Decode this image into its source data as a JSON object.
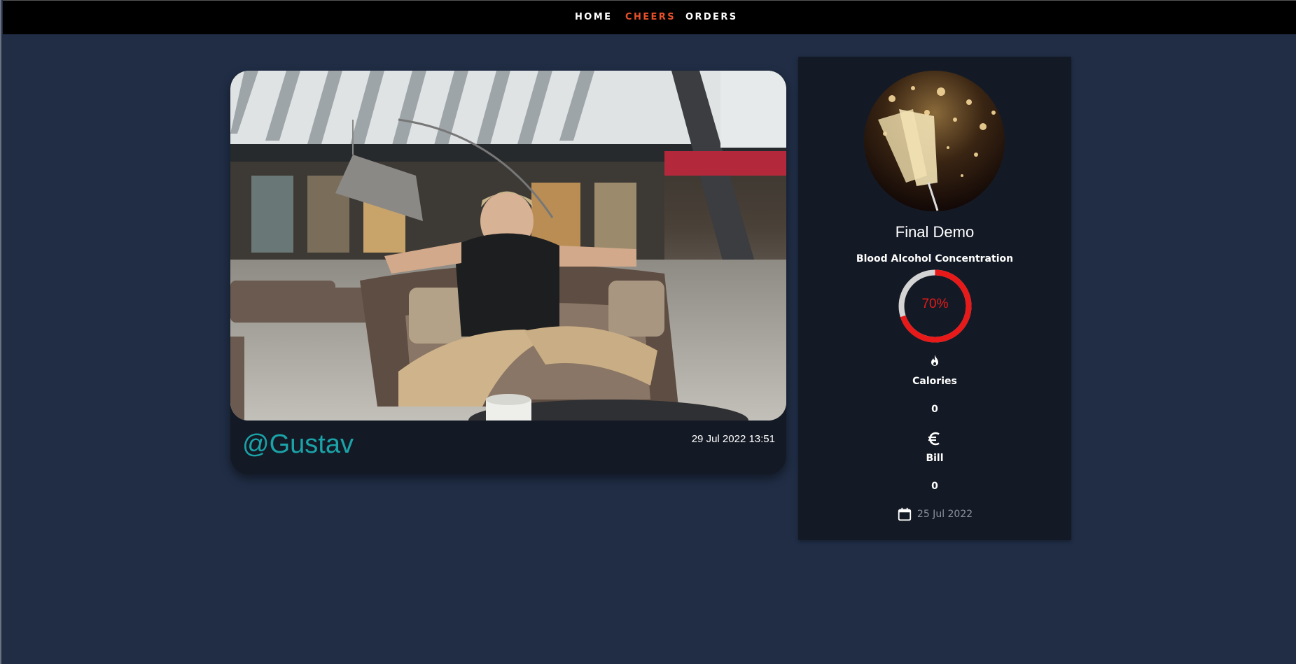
{
  "nav": {
    "items": [
      {
        "label": "HOME",
        "active": false
      },
      {
        "label": "CHEERS",
        "active": true
      },
      {
        "label": "ORDERS",
        "active": false
      }
    ],
    "active_color": "#e8502b"
  },
  "post": {
    "author": "@Gustav",
    "timestamp": "29 Jul 2022 13:51",
    "photo_description": "image",
    "author_color": "#1aa3a8"
  },
  "profile": {
    "name": "Final Demo",
    "avatar": "champagne-glasses-avatar",
    "bac": {
      "label": "Blood Alcohol Concentration",
      "value_text": "70%",
      "fraction": 0.7,
      "color": "#e81919"
    },
    "calories": {
      "icon": "flame-icon",
      "label": "Calories",
      "value": "0"
    },
    "bill": {
      "icon": "euro-icon",
      "label": "Bill",
      "value": "0"
    },
    "joined": {
      "icon": "calendar-icon",
      "date": "25 Jul 2022"
    }
  },
  "colors": {
    "background": "#202d45",
    "card": "#141a25",
    "nav": "#000000"
  }
}
